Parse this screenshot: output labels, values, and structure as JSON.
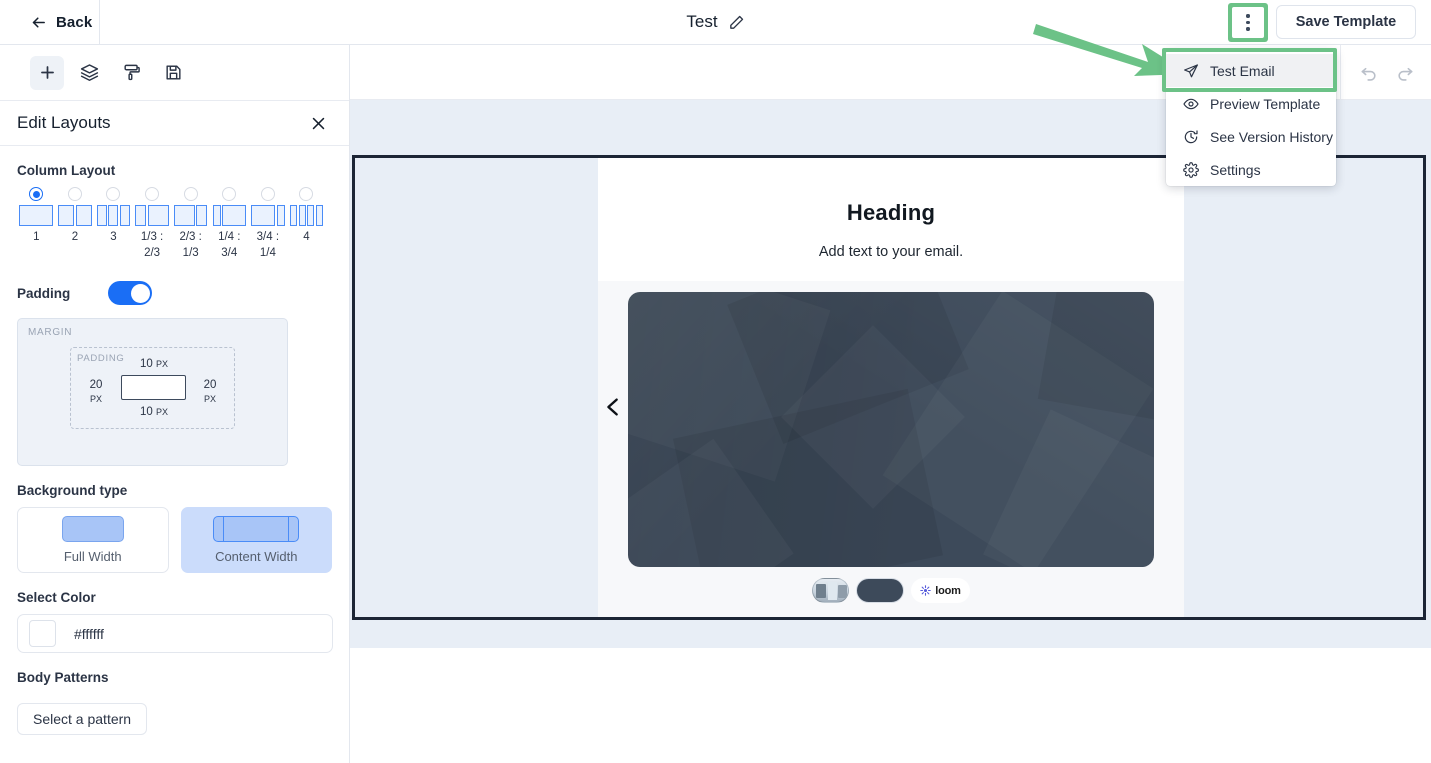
{
  "topbar": {
    "back_label": "Back",
    "doc_title": "Test",
    "edit_icon": "pencil-icon",
    "kebab_icon": "more-vertical-icon",
    "save_label": "Save Template"
  },
  "menu": {
    "items": [
      {
        "label": "Test Email",
        "icon": "send-icon",
        "highlighted": true
      },
      {
        "label": "Preview Template",
        "icon": "eye-icon",
        "highlighted": false
      },
      {
        "label": "See Version History",
        "icon": "clock-icon",
        "highlighted": false
      },
      {
        "label": "Settings",
        "icon": "gear-icon",
        "highlighted": false
      }
    ]
  },
  "annotation": {
    "arrow_color": "#6cc287",
    "highlight_color": "#6cc287"
  },
  "left_panel": {
    "tools": [
      {
        "name": "add-block-tool",
        "icon": "plus-icon",
        "active": true
      },
      {
        "name": "layers-tool",
        "icon": "layers-icon",
        "active": false
      },
      {
        "name": "style-tool",
        "icon": "paint-roller-icon",
        "active": false
      },
      {
        "name": "save-tool",
        "icon": "floppy-disk-icon",
        "active": false
      }
    ],
    "panel_title": "Edit Layouts",
    "close_icon": "close-icon",
    "column_layout": {
      "label": "Column Layout",
      "selected_index": 0,
      "options": [
        {
          "label": "1",
          "cols": [
            1
          ]
        },
        {
          "label": "2",
          "cols": [
            1,
            1
          ]
        },
        {
          "label": "3",
          "cols": [
            1,
            1,
            1
          ]
        },
        {
          "label": "1/3 :\n2/3",
          "cols": [
            1,
            2
          ]
        },
        {
          "label": "2/3 :\n1/3",
          "cols": [
            2,
            1
          ]
        },
        {
          "label": "1/4 :\n3/4",
          "cols": [
            1,
            3
          ]
        },
        {
          "label": "3/4 :\n1/4",
          "cols": [
            3,
            1
          ]
        },
        {
          "label": "4",
          "cols": [
            1,
            1,
            1,
            1
          ]
        }
      ]
    },
    "padding": {
      "label": "Padding",
      "enabled": true,
      "margin_label": "MARGIN",
      "padding_label": "PADDING",
      "top": "10",
      "bottom": "10",
      "left": "20",
      "right": "20",
      "unit": "PX"
    },
    "background_type": {
      "label": "Background type",
      "options": [
        {
          "label": "Full Width",
          "selected": false
        },
        {
          "label": "Content Width",
          "selected": true
        }
      ]
    },
    "select_color": {
      "label": "Select Color",
      "value": "#ffffff"
    },
    "body_patterns": {
      "label": "Body Patterns",
      "button_label": "Select a pattern"
    }
  },
  "editor": {
    "undo_icon": "undo-icon",
    "redo_icon": "redo-icon",
    "prev_icon": "chevron-left-icon",
    "next_icon": "chevron-right-icon"
  },
  "email_preview": {
    "heading": "Heading",
    "subtext": "Add text to your email.",
    "video": {
      "provider_label": "loom",
      "provider_icon": "loom-logo-icon"
    }
  }
}
